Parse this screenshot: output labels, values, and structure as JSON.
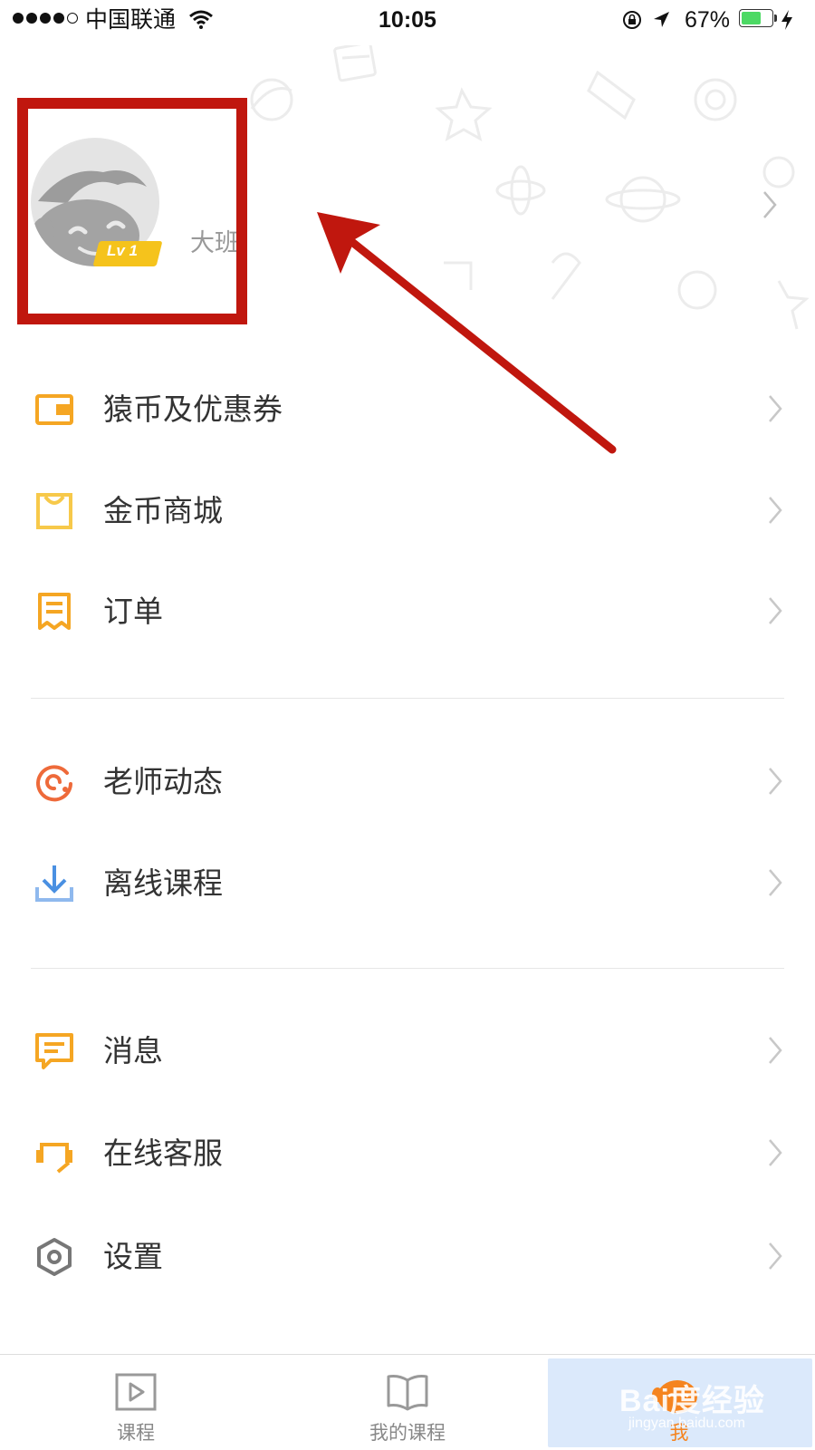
{
  "status_bar": {
    "carrier": "中国联通",
    "time": "10:05",
    "battery_percent": "67%",
    "battery_level": 0.67,
    "icons": [
      "signal-dots-icon",
      "wifi-icon",
      "orientation-lock-icon",
      "location-arrow-icon",
      "battery-icon",
      "charging-bolt-icon"
    ]
  },
  "profile": {
    "level_badge": "Lv 1",
    "grade": "大班",
    "avatar_icon": "monkey-avatar-icon"
  },
  "annotation": {
    "box_color": "#c0170e",
    "arrow_color": "#c0170e"
  },
  "menu": {
    "group1": [
      {
        "label": "猿币及优惠券",
        "icon": "wallet-icon",
        "color": "#f5a623"
      },
      {
        "label": "金币商城",
        "icon": "shopping-bag-icon",
        "color": "#f7c94a"
      },
      {
        "label": "订单",
        "icon": "receipt-icon",
        "color": "#f5a623"
      }
    ],
    "group2": [
      {
        "label": "老师动态",
        "icon": "teacher-feed-icon",
        "color": "#ee6a3a"
      },
      {
        "label": "离线课程",
        "icon": "download-icon",
        "color": "#4a90e2"
      }
    ],
    "group3": [
      {
        "label": "消息",
        "icon": "message-icon",
        "color": "#f5a623"
      },
      {
        "label": "在线客服",
        "icon": "headset-icon",
        "color": "#f5a623"
      },
      {
        "label": "设置",
        "icon": "settings-hexagon-icon",
        "color": "#777777"
      }
    ]
  },
  "tab_bar": {
    "tabs": [
      {
        "label": "课程",
        "icon": "play-icon"
      },
      {
        "label": "我的课程",
        "icon": "book-icon"
      },
      {
        "label": "我",
        "icon": "monkey-face-icon",
        "active": true
      }
    ],
    "active_color": "#f5841f",
    "active_bg": "#dbe9fb"
  },
  "watermark": {
    "brand": "Bai度经验",
    "url": "jingyan.baidu.com"
  }
}
